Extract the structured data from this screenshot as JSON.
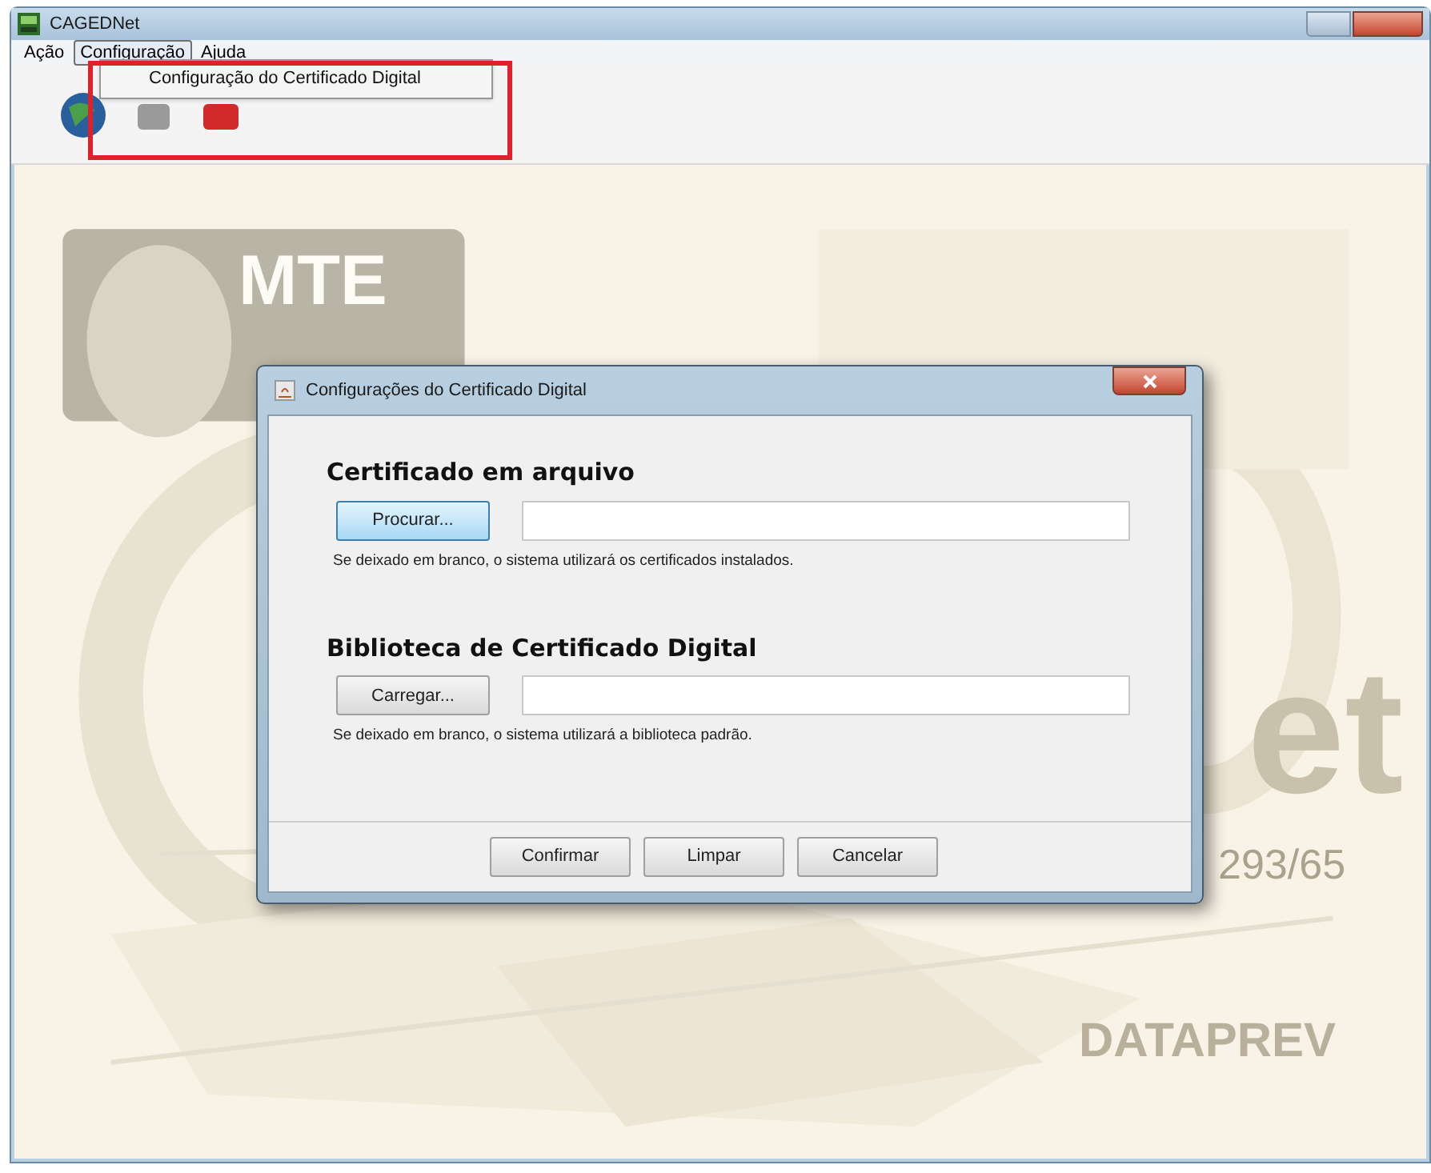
{
  "window": {
    "title": "CAGEDNet"
  },
  "menu_bar": [
    {
      "label": "Ação",
      "selected": false
    },
    {
      "label": "Configuração",
      "selected": true
    },
    {
      "label": "Ajuda",
      "selected": false
    }
  ],
  "menu_popup": {
    "items": [
      "Configuração do Certificado Digital"
    ],
    "highlighted": true
  },
  "splash": {
    "logo_text": "MTE",
    "product_text": "et",
    "code_text": "293/65",
    "footer_logo": "DATAPREV"
  },
  "dialog": {
    "title": "Configurações do Certificado Digital",
    "sections": [
      {
        "heading": "Certificado em arquivo",
        "button": "Procurar...",
        "focused": true,
        "hint": "Se deixado em branco, o sistema utilizará os certificados instalados."
      },
      {
        "heading": "Biblioteca de Certificado Digital",
        "button": "Carregar...",
        "focused": false,
        "hint": "Se deixado em branco, o sistema utilizará a biblioteca padrão."
      }
    ],
    "buttons": [
      "Confirmar",
      "Limpar",
      "Cancelar"
    ]
  }
}
